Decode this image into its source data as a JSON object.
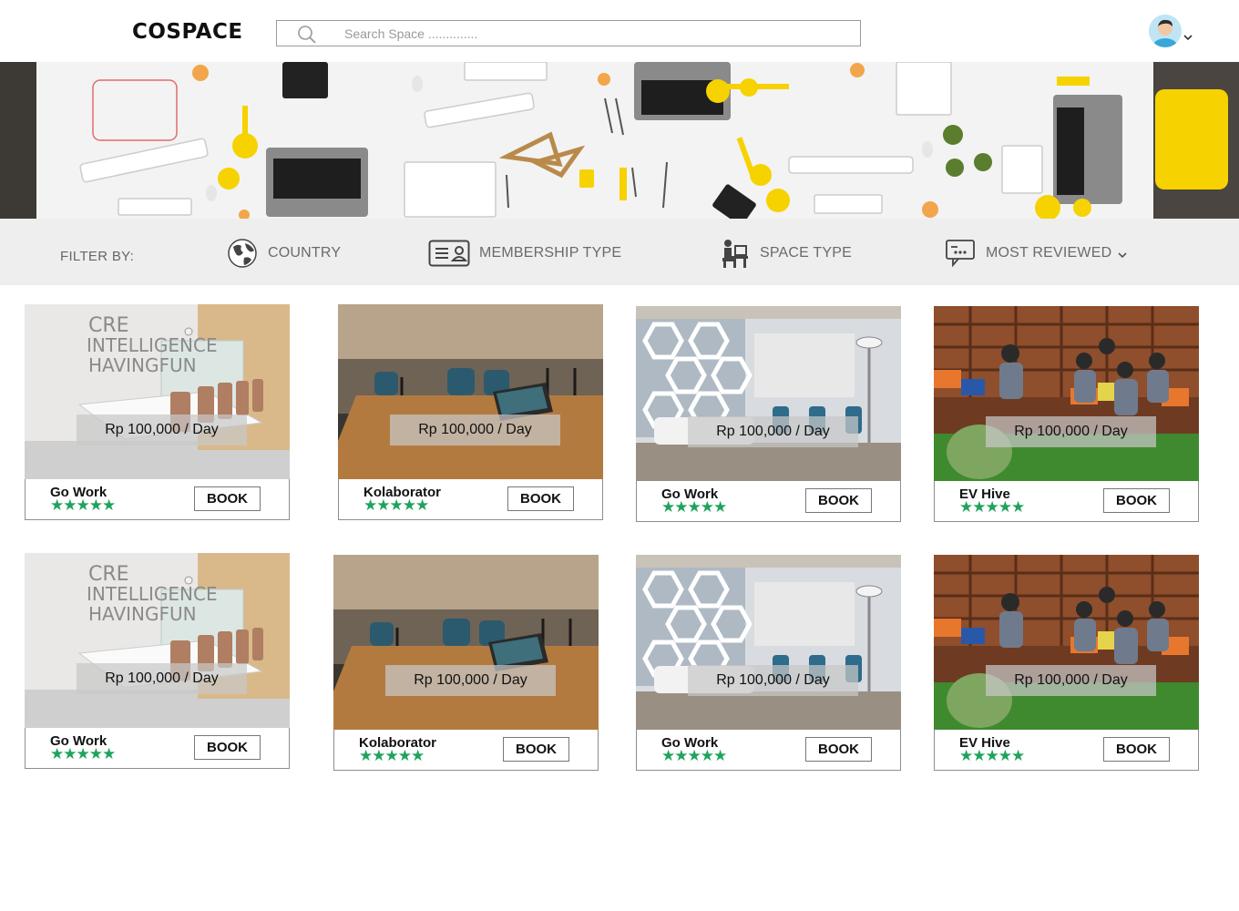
{
  "header": {
    "logo": "COSPACE",
    "search_placeholder": "Search Space ..............",
    "search_value": ""
  },
  "filters": {
    "label": "FILTER BY:",
    "items": [
      {
        "label": "COUNTRY",
        "icon": "globe-icon"
      },
      {
        "label": "MEMBERSHIP TYPE",
        "icon": "id-card-icon"
      },
      {
        "label": "SPACE TYPE",
        "icon": "workstation-icon"
      },
      {
        "label": "MOST REVIEWED",
        "icon": "review-chat-icon",
        "dropdown": true
      }
    ]
  },
  "listings": [
    {
      "name": "Go Work",
      "price": "Rp 100,000 / Day",
      "rating": 5,
      "stars": "★★★★★",
      "book_label": "BOOK",
      "photo": "meeting-room"
    },
    {
      "name": "Kolaborator",
      "price": "Rp 100,000 / Day",
      "rating": 5,
      "stars": "★★★★★",
      "book_label": "BOOK",
      "photo": "cafe-laptop"
    },
    {
      "name": "Go Work",
      "price": "Rp 100,000 / Day",
      "rating": 5,
      "stars": "★★★★★",
      "book_label": "BOOK",
      "photo": "hexagon-office"
    },
    {
      "name": "EV Hive",
      "price": "Rp 100,000 / Day",
      "rating": 5,
      "stars": "★★★★★",
      "book_label": "BOOK",
      "photo": "lounge-people"
    },
    {
      "name": "Go Work",
      "price": "Rp 100,000 / Day",
      "rating": 5,
      "stars": "★★★★★",
      "book_label": "BOOK",
      "photo": "meeting-room"
    },
    {
      "name": "Kolaborator",
      "price": "Rp 100,000 / Day",
      "rating": 5,
      "stars": "★★★★★",
      "book_label": "BOOK",
      "photo": "cafe-laptop"
    },
    {
      "name": "Go Work",
      "price": "Rp 100,000 / Day",
      "rating": 5,
      "stars": "★★★★★",
      "book_label": "BOOK",
      "photo": "hexagon-office"
    },
    {
      "name": "EV Hive",
      "price": "Rp 100,000 / Day",
      "rating": 5,
      "stars": "★★★★★",
      "book_label": "BOOK",
      "photo": "lounge-people"
    }
  ],
  "colors": {
    "star": "#1fa35c",
    "filter_bar_bg": "#eeeeee",
    "accent_yellow": "#f6d200"
  }
}
